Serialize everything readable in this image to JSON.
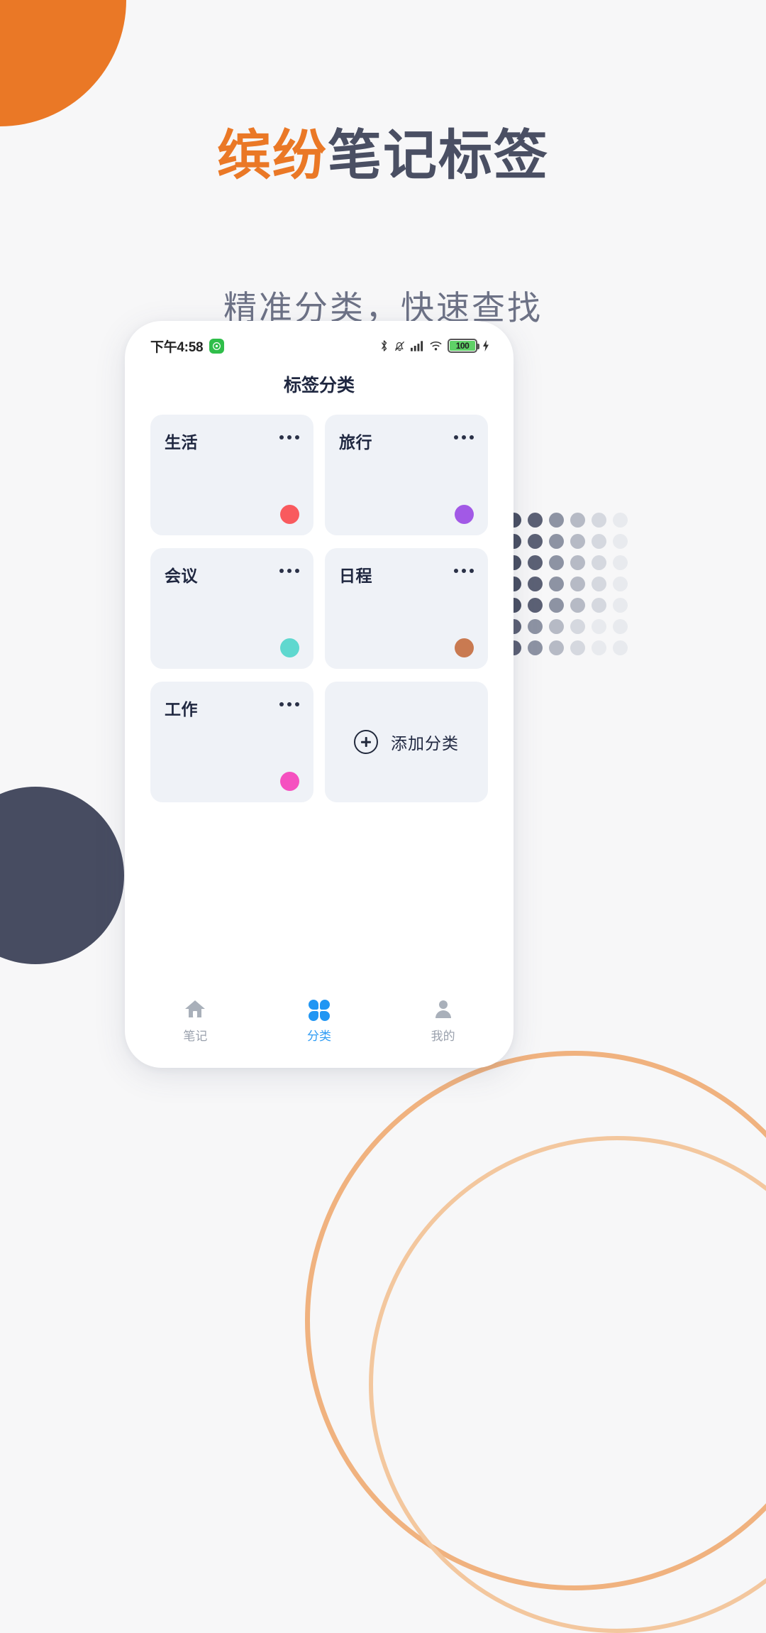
{
  "promo": {
    "headline_accent": "缤纷",
    "headline_main": "笔记标签",
    "subhead": "精准分类，快速查找",
    "accent_color": "#ea7826",
    "main_color": "#4a4f63"
  },
  "phone": {
    "statusbar": {
      "time": "下午4:58",
      "app_badge": "◎",
      "battery_percent": "100",
      "icons": [
        "bluetooth-icon",
        "mute-bell-icon",
        "signal-icon",
        "wifi-icon",
        "battery-icon",
        "charging-bolt-icon"
      ]
    },
    "nav": {
      "title": "标签分类"
    },
    "categories": [
      {
        "name": "生活",
        "color": "#f95a5e",
        "menu": "more-icon"
      },
      {
        "name": "旅行",
        "color": "#a259e6",
        "menu": "more-icon"
      },
      {
        "name": "会议",
        "color": "#5fd8cf",
        "menu": "more-icon"
      },
      {
        "name": "日程",
        "color": "#c97a51",
        "menu": "more-icon"
      },
      {
        "name": "工作",
        "color": "#f551c0",
        "menu": "more-icon"
      }
    ],
    "add_card": {
      "label": "添加分类",
      "icon": "plus-circle-icon"
    },
    "tabbar": {
      "active_color": "#2f9cf4",
      "inactive_color": "#9aa1ad",
      "items": [
        {
          "label": "笔记",
          "icon": "home-icon",
          "active": false
        },
        {
          "label": "分类",
          "icon": "grid-petals-icon",
          "active": true
        },
        {
          "label": "我的",
          "icon": "person-icon",
          "active": false
        }
      ]
    }
  },
  "decor": {
    "quarter_circle_color": "#ea7826",
    "dark_circle_color": "#474c61",
    "arc_color": "#f0b27f",
    "dot_matrix_colors": [
      "#4a5064",
      "#5c6175",
      "#8d93a3",
      "#b6bac5",
      "#d5d8df",
      "#e8eaee"
    ]
  }
}
